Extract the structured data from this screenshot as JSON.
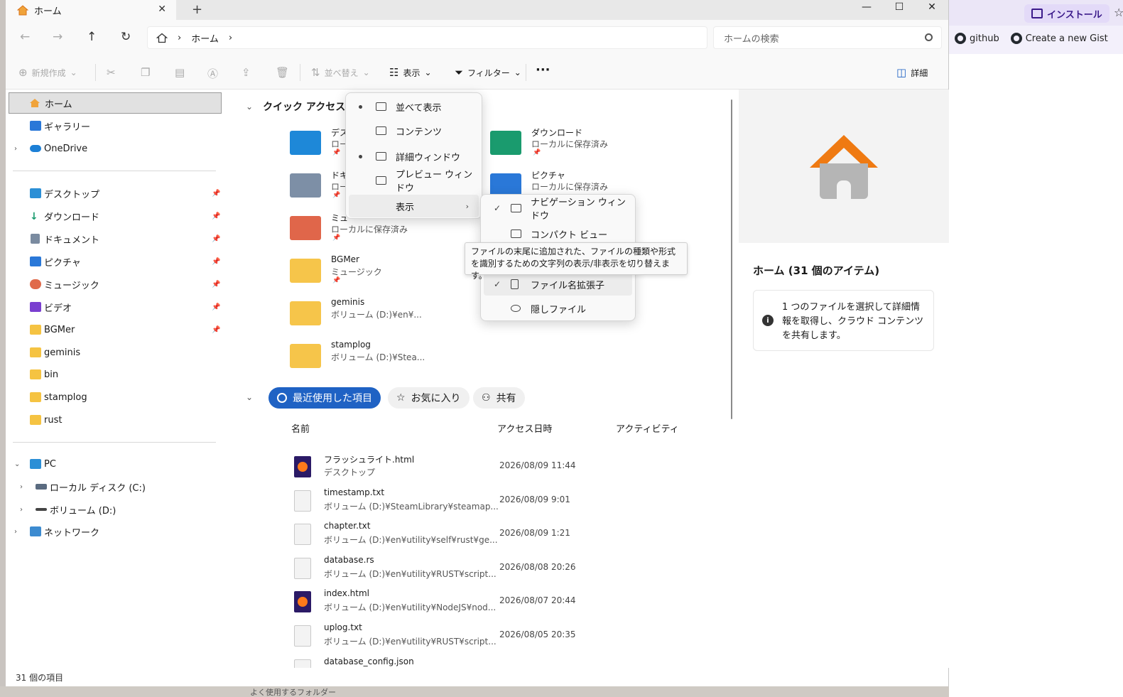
{
  "browser": {
    "install_label": "インストール",
    "bookmarks": [
      {
        "label": "github",
        "icon": "github-icon"
      },
      {
        "label": "Create a new Gist",
        "icon": "github-icon"
      }
    ]
  },
  "window": {
    "tab_title": "ホーム",
    "new_tab": "+",
    "close_tab": "✕",
    "controls": {
      "minimize": "—",
      "maximize": "☐",
      "close": "✕"
    }
  },
  "address": {
    "path_home": "ホーム",
    "search_placeholder": "ホームの検索"
  },
  "toolbar": {
    "new": "新規作成",
    "sort": "並べ替え",
    "view": "表示",
    "filter": "フィルター",
    "more": "···",
    "details": "詳細"
  },
  "sidebar": {
    "home": "ホーム",
    "gallery": "ギャラリー",
    "onedrive": "OneDrive",
    "pinned": [
      {
        "label": "デスクトップ",
        "icon": "desktop-icon",
        "color": "#2b8fd6"
      },
      {
        "label": "ダウンロード",
        "icon": "download-icon",
        "color": "#1a9b6e"
      },
      {
        "label": "ドキュメント",
        "icon": "document-icon",
        "color": "#7a8ba0"
      },
      {
        "label": "ピクチャ",
        "icon": "pictures-icon",
        "color": "#2a78d8"
      },
      {
        "label": "ミュージック",
        "icon": "music-icon",
        "color": "#e06a4a"
      },
      {
        "label": "ビデオ",
        "icon": "video-icon",
        "color": "#7a3fd0"
      },
      {
        "label": "BGMer",
        "icon": "folder-icon",
        "color": "#f5c342"
      }
    ],
    "folders": [
      "geminis",
      "bin",
      "stamplog",
      "rust"
    ],
    "pc": "PC",
    "local_disk": "ローカル ディスク (C:)",
    "volume_d": "ボリューム (D:)",
    "network": "ネットワーク"
  },
  "content": {
    "quick_access_title": "クイック アクセス",
    "quick_access": [
      {
        "name": "デス",
        "sub": "ローカ",
        "color": "#1e88d8"
      },
      {
        "name": "ダウンロード",
        "sub": "ローカルに保存済み",
        "color": "#1a9b6e"
      },
      {
        "name": "ドキ",
        "sub": "ロー",
        "color": "#7d8fa6"
      },
      {
        "name": "ピクチャ",
        "sub": "ローカルに保存済み",
        "color": "#2a78d8"
      },
      {
        "name": "ミュー",
        "sub": "ローカルに保存済み",
        "color": "#e0664a"
      },
      {
        "name": "BGMer",
        "sub": "ミュージック",
        "color": "#f6c54a"
      },
      {
        "name": "geminis",
        "sub": "ボリューム (D:)¥en¥...",
        "color": "#f6c54a"
      },
      {
        "name": "stamplog",
        "sub": "ボリューム (D:)¥Stea...",
        "color": "#f6c54a"
      }
    ],
    "tabs": {
      "recent": "最近使用した項目",
      "favorites": "お気に入り",
      "shared": "共有"
    },
    "columns": {
      "name": "名前",
      "date": "アクセス日時",
      "activity": "アクティビティ"
    },
    "files": [
      {
        "name": "フラッシュライト.html",
        "path": "デスクトップ",
        "date": "2026/08/09 11:44",
        "ff": true
      },
      {
        "name": "timestamp.txt",
        "path": "ボリューム (D:)¥SteamLibrary¥steamap...",
        "date": "2026/08/09 9:01",
        "ff": false
      },
      {
        "name": "chapter.txt",
        "path": "ボリューム (D:)¥en¥utility¥self¥rust¥ge...",
        "date": "2026/08/09 1:21",
        "ff": false
      },
      {
        "name": "database.rs",
        "path": "ボリューム (D:)¥en¥utility¥RUST¥script...",
        "date": "2026/08/08 20:26",
        "ff": false
      },
      {
        "name": "index.html",
        "path": "ボリューム (D:)¥en¥utility¥NodeJS¥nod...",
        "date": "2026/08/07 20:44",
        "ff": true
      },
      {
        "name": "uplog.txt",
        "path": "ボリューム (D:)¥en¥utility¥RUST¥script...",
        "date": "2026/08/05 20:35",
        "ff": false
      },
      {
        "name": "database_config.json",
        "path": "",
        "date": "",
        "ff": false
      }
    ]
  },
  "details": {
    "title": "ホーム (31 個のアイテム)",
    "info": "1 つのファイルを選択して詳細情報を取得し、クラウド コンテンツを共有します。"
  },
  "view_menu": {
    "items": [
      "並べて表示",
      "コンテンツ",
      "詳細ウィンドウ",
      "プレビュー ウィンドウ",
      "表示"
    ]
  },
  "show_submenu": {
    "items": [
      "ナビゲーション ウィンドウ",
      "コンパクト ビュー",
      "ファイル名拡張子",
      "隠しファイル"
    ]
  },
  "tooltip": "ファイルの末尾に追加された、ファイルの種類や形式を識別するための文字列の表示/非表示を切り替えます。",
  "status": "31 個の項目",
  "bottom_text": "よく使用するフォルダー"
}
